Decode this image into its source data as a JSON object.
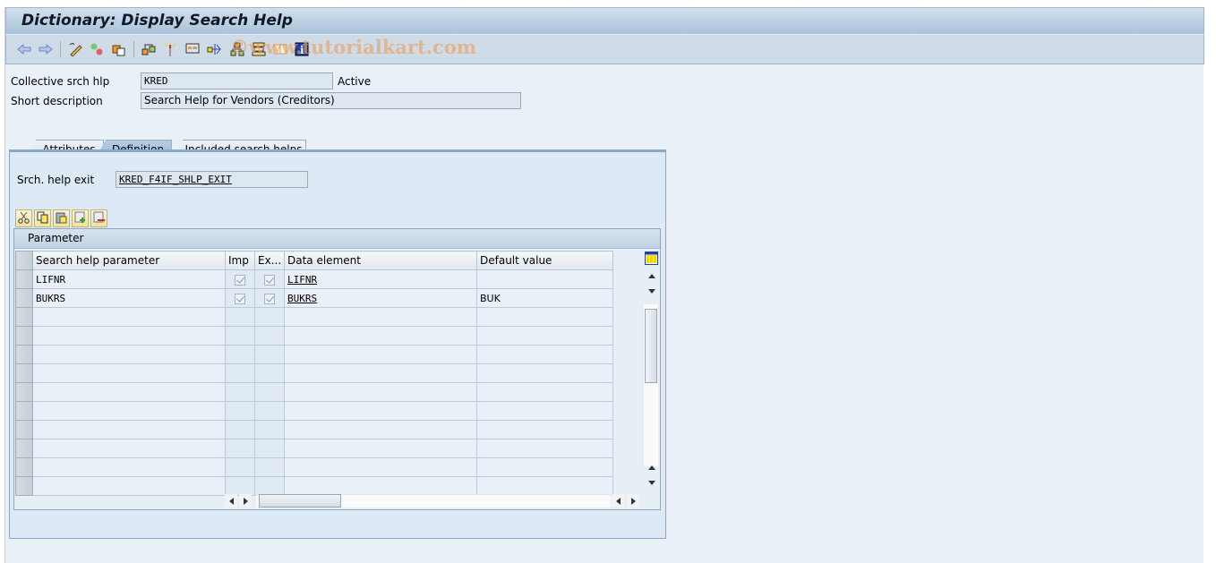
{
  "window": {
    "title": "Dictionary: Display Search Help"
  },
  "toolbar": {
    "icons": [
      "back-icon",
      "forward-icon",
      "display-change-icon",
      "active-inactive-icon",
      "other-object-icon",
      "where-used-icon",
      "activate-icon",
      "display-object-list-icon",
      "navigate-icon",
      "hierarchy-icon",
      "object-directory-icon",
      "documentation-icon",
      "info-icon"
    ],
    "watermark": "©www.tutorialkart.com"
  },
  "header": {
    "collective_label": "Collective srch hlp",
    "collective_value": "KRED",
    "status": "Active",
    "short_desc_label": "Short description",
    "short_desc_value": "Search Help for Vendors (Creditors)"
  },
  "tabs": [
    {
      "label": "Attributes",
      "active": false
    },
    {
      "label": "Definition",
      "active": true
    },
    {
      "label": "Included search helps",
      "active": false
    }
  ],
  "definition": {
    "exit_label": "Srch. help exit",
    "exit_value": "KRED_F4IF_SHLP_EXIT",
    "grid_toolbar": [
      "cut-icon",
      "copy-icon",
      "paste-icon",
      "insert-row-icon",
      "delete-row-icon"
    ],
    "grid_title": "Parameter",
    "columns": [
      "Search help parameter",
      "Imp",
      "Ex...",
      "Data element",
      "Default value"
    ],
    "rows": [
      {
        "param": "LIFNR",
        "imp": true,
        "exp": true,
        "data_element": "LIFNR",
        "default": ""
      },
      {
        "param": "BUKRS",
        "imp": true,
        "exp": true,
        "data_element": "BUKRS",
        "default": "BUK"
      }
    ],
    "empty_rows": 10
  }
}
